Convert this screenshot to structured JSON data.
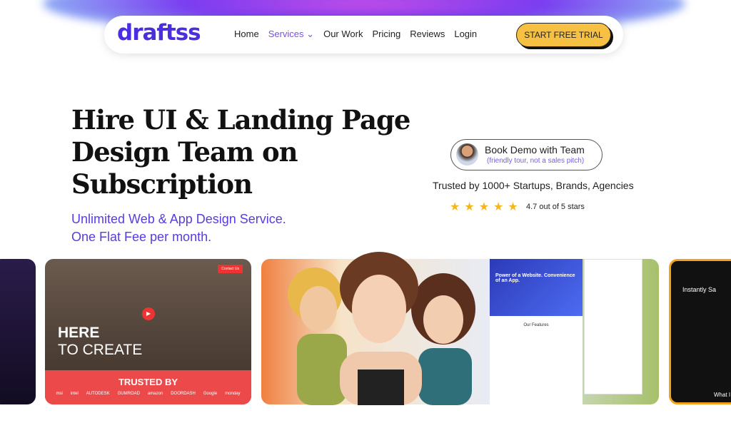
{
  "nav": {
    "logo": "draftss",
    "items": [
      {
        "label": "Home"
      },
      {
        "label": "Services"
      },
      {
        "label": "Our Work"
      },
      {
        "label": "Pricing"
      },
      {
        "label": "Reviews"
      },
      {
        "label": "Login"
      }
    ],
    "cta": "START FREE TRIAL"
  },
  "hero": {
    "title": "Hire UI & Landing Page Design Team on Subscription",
    "subtitle_line1": "Unlimited Web & App Design Service.",
    "subtitle_line2": "One Flat Fee per month."
  },
  "demo": {
    "label": "Book Demo with Team",
    "note": "(friendly tour, not a sales pitch)"
  },
  "trusted": "Trusted by 1000+ Startups, Brands, Agencies",
  "rating": {
    "stars": "★★★★★",
    "text": "4.7 out of 5 stars",
    "value": 4.7
  },
  "showcase": {
    "card1": {
      "here": "HERE",
      "create": "TO CREATE",
      "trusted": "TRUSTED BY",
      "logos": [
        "msi",
        "intel",
        "AUTODESK",
        "GUMROAD",
        "amazon",
        "DOORDASH",
        "Google",
        "monday"
      ]
    },
    "card2": {
      "hero": "Power of a Website. Convenience of an App.",
      "features": "Our Features"
    },
    "card3": {
      "title": "Instantly Sa",
      "bottom": "What I"
    }
  },
  "colors": {
    "brand": "#4b2ee0",
    "accent": "#f6c143",
    "purple_text": "#5a3be0"
  }
}
